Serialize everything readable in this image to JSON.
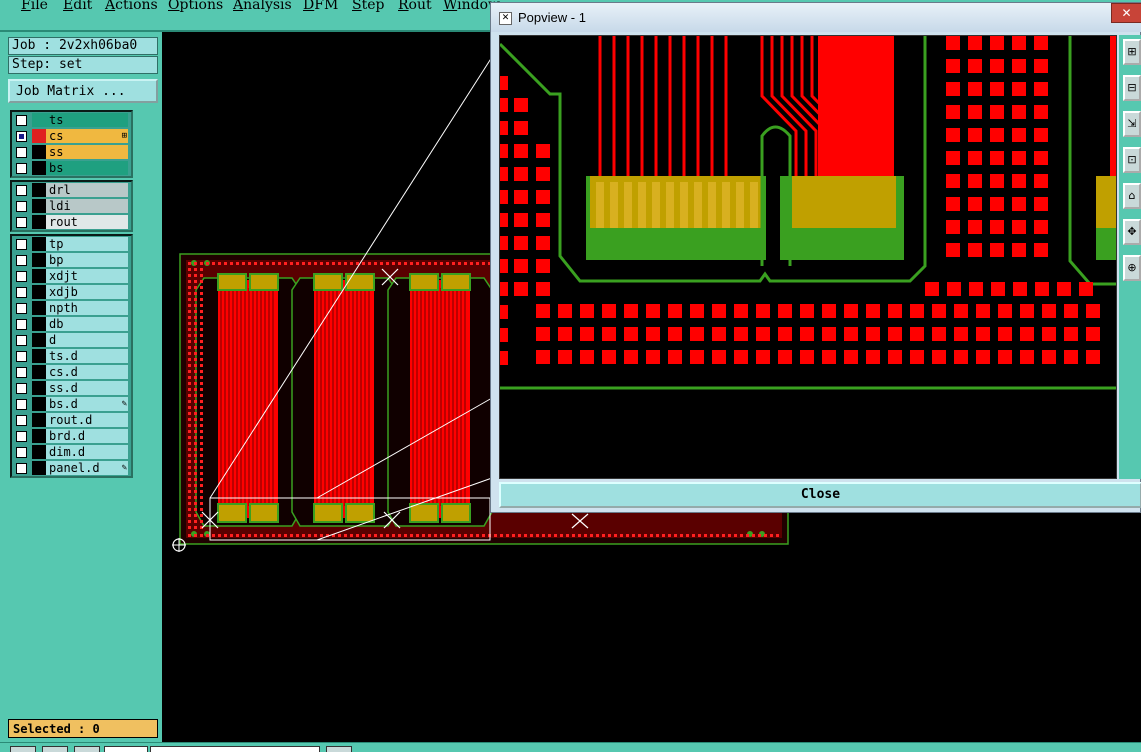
{
  "menu": {
    "items": [
      "File",
      "Edit",
      "Actions",
      "Options",
      "Analysis",
      "DFM",
      "Step",
      "Rout",
      "Window"
    ]
  },
  "job": {
    "label": "Job : 2v2xh06ba0",
    "step": "Step: set",
    "matrix_button": "Job Matrix ..."
  },
  "layers": {
    "signal": [
      {
        "name": "ts",
        "color": "#1fa080",
        "checked": false
      },
      {
        "name": "cs",
        "color": "#f0b840",
        "checked": true
      },
      {
        "name": "ss",
        "color": "#f0b840",
        "checked": false
      },
      {
        "name": "bs",
        "color": "#1fa080",
        "checked": false
      }
    ],
    "signal_swatches": [
      "#1fa080",
      "#e02020",
      "#000000",
      "#000000"
    ],
    "drill": [
      {
        "name": "drl",
        "color": "#b8c8c8"
      },
      {
        "name": "ldi",
        "color": "#b8c8c8"
      },
      {
        "name": "rout",
        "color": "#e0e8e8"
      }
    ],
    "other": [
      {
        "name": "tp"
      },
      {
        "name": "bp"
      },
      {
        "name": "xdjt"
      },
      {
        "name": "xdjb"
      },
      {
        "name": "npth"
      },
      {
        "name": "db"
      },
      {
        "name": "d"
      },
      {
        "name": "ts.d"
      },
      {
        "name": "cs.d"
      },
      {
        "name": "ss.d"
      },
      {
        "name": "bs.d"
      },
      {
        "name": "rout.d"
      },
      {
        "name": "brd.d"
      },
      {
        "name": "dim.d"
      },
      {
        "name": "panel.d"
      }
    ],
    "other_color": "#9fe0e0"
  },
  "status": {
    "selected": "Selected : 0"
  },
  "popview": {
    "title": "Popview - 1",
    "close_label": "Close"
  },
  "colors": {
    "accent": "#56c8b0",
    "copper": "#ff0000",
    "outline": "#3aa020",
    "pad": "#c0a000"
  }
}
